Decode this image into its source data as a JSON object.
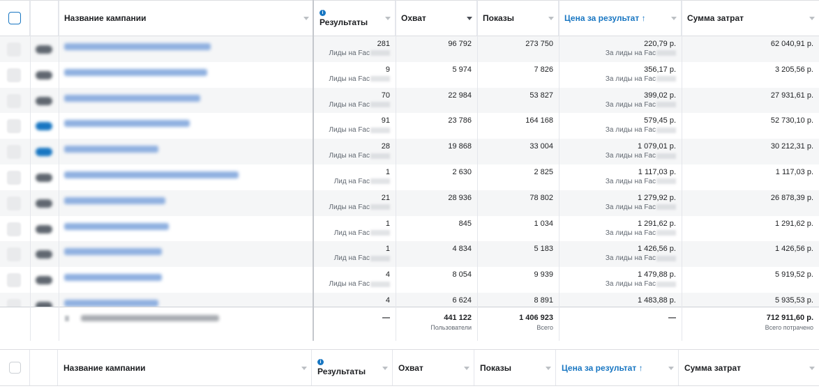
{
  "columns": {
    "name": "Название кампании",
    "results": "Результаты",
    "reach": "Охват",
    "impressions": "Показы",
    "cost_per_result": "Цена за результат",
    "sort_arrow": "↑",
    "amount_spent": "Сумма затрат"
  },
  "rows": [
    {
      "results": "281",
      "results_sub": "Лиды на Fac",
      "reach": "96 792",
      "impressions": "273 750",
      "cpr": "220,79 р.",
      "cpr_sub": "За лиды на Fac",
      "spent": "62 040,91 р.",
      "toggle": "off",
      "name_w": 210
    },
    {
      "results": "9",
      "results_sub": "Лиды на Fac",
      "reach": "5 974",
      "impressions": "7 826",
      "cpr": "356,17 р.",
      "cpr_sub": "За лиды на Fac",
      "spent": "3 205,56 р.",
      "toggle": "off",
      "name_w": 205
    },
    {
      "results": "70",
      "results_sub": "Лиды на Fac",
      "reach": "22 984",
      "impressions": "53 827",
      "cpr": "399,02 р.",
      "cpr_sub": "За лиды на Fac",
      "spent": "27 931,61 р.",
      "toggle": "off",
      "name_w": 195
    },
    {
      "results": "91",
      "results_sub": "Лиды на Fac",
      "reach": "23 786",
      "impressions": "164 168",
      "cpr": "579,45 р.",
      "cpr_sub": "За лиды на Fac",
      "spent": "52 730,10 р.",
      "toggle": "on",
      "name_w": 180
    },
    {
      "results": "28",
      "results_sub": "Лиды на Fac",
      "reach": "19 868",
      "impressions": "33 004",
      "cpr": "1 079,01 р.",
      "cpr_sub": "За лиды на Fac",
      "spent": "30 212,31 р.",
      "toggle": "on",
      "name_w": 135
    },
    {
      "results": "1",
      "results_sub": "Лид на Fac",
      "reach": "2 630",
      "impressions": "2 825",
      "cpr": "1 117,03 р.",
      "cpr_sub": "За лиды на Fac",
      "spent": "1 117,03 р.",
      "toggle": "off",
      "name_w": 250
    },
    {
      "results": "21",
      "results_sub": "Лиды на Fac",
      "reach": "28 936",
      "impressions": "78 802",
      "cpr": "1 279,92 р.",
      "cpr_sub": "За лиды на Fac",
      "spent": "26 878,39 р.",
      "toggle": "off",
      "name_w": 145
    },
    {
      "results": "1",
      "results_sub": "Лид на Fac",
      "reach": "845",
      "impressions": "1 034",
      "cpr": "1 291,62 р.",
      "cpr_sub": "За лиды на Fac",
      "spent": "1 291,62 р.",
      "toggle": "off",
      "name_w": 150
    },
    {
      "results": "1",
      "results_sub": "Лид на Fac",
      "reach": "4 834",
      "impressions": "5 183",
      "cpr": "1 426,56 р.",
      "cpr_sub": "За лиды на Fac",
      "spent": "1 426,56 р.",
      "toggle": "off",
      "name_w": 140
    },
    {
      "results": "4",
      "results_sub": "Лиды на Fac",
      "reach": "8 054",
      "impressions": "9 939",
      "cpr": "1 479,88 р.",
      "cpr_sub": "За лиды на Fac",
      "spent": "5 919,52 р.",
      "toggle": "off",
      "name_w": 140
    },
    {
      "results": "4",
      "results_sub": "",
      "reach": "6 624",
      "impressions": "8 891",
      "cpr": "1 483,88 р.",
      "cpr_sub": "",
      "spent": "5 935,53 р.",
      "toggle": "off",
      "name_w": 135
    }
  ],
  "totals": {
    "results": "—",
    "reach": "441 122",
    "reach_sub": "Пользователи",
    "impressions": "1 406 923",
    "impressions_sub": "Всего",
    "cpr": "—",
    "spent": "712 911,60 р.",
    "spent_sub": "Всего потрачено"
  }
}
